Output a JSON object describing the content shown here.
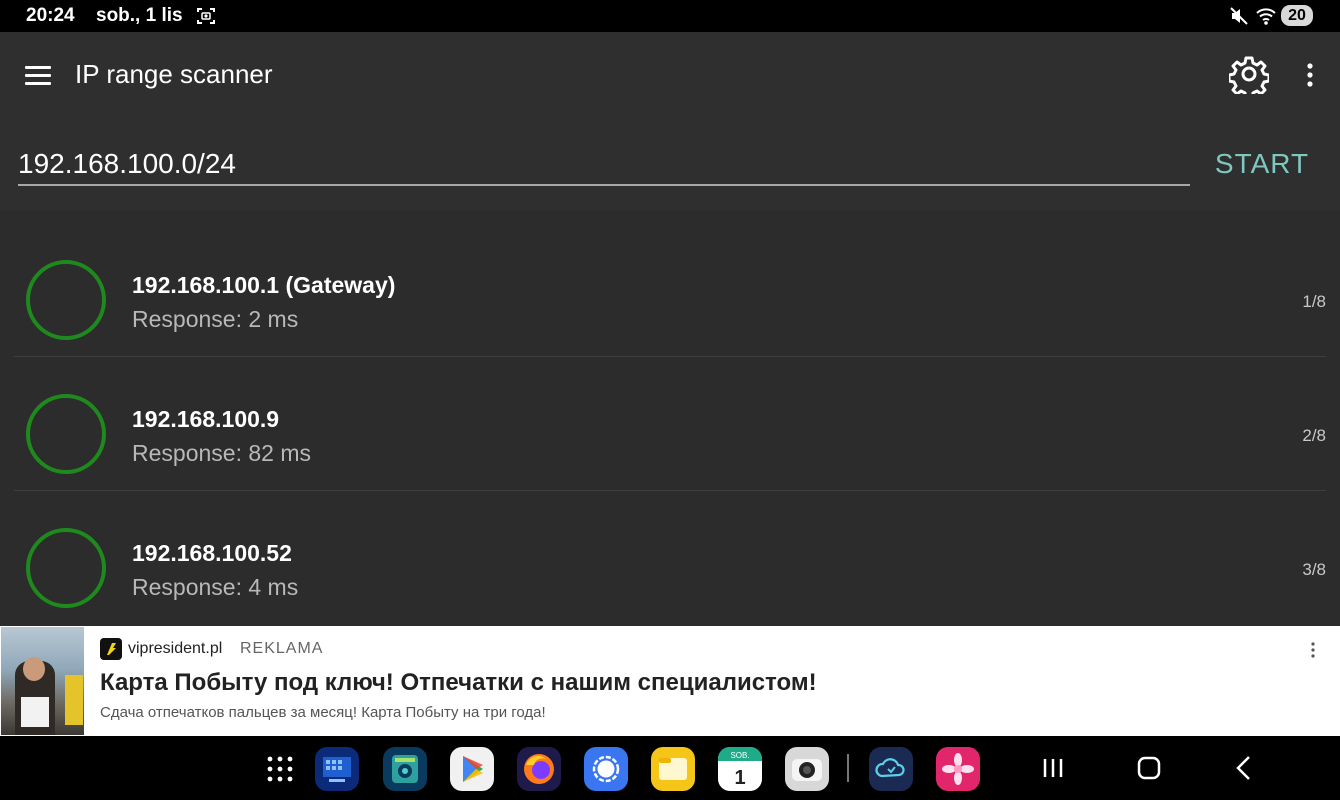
{
  "status_bar": {
    "time": "20:24",
    "date": "sob., 1 lis",
    "battery": "20",
    "icons": [
      "screenshot-icon",
      "mute-icon",
      "wifi-icon",
      "battery-icon"
    ]
  },
  "app_bar": {
    "title": "IP range scanner",
    "icons": [
      "menu-icon",
      "gear-icon",
      "overflow-menu-icon"
    ]
  },
  "scan": {
    "range_value": "192.168.100.0/24",
    "start_label": "START",
    "accent_color": "#7ec8c0"
  },
  "results": [
    {
      "host": "192.168.100.1 (Gateway)",
      "response": "Response: 2 ms",
      "counter": "1/8"
    },
    {
      "host": "192.168.100.9",
      "response": "Response: 82 ms",
      "counter": "2/8"
    },
    {
      "host": "192.168.100.52",
      "response": "Response: 4 ms",
      "counter": "3/8"
    }
  ],
  "status_ring_color": "#1e8a1e",
  "ad": {
    "source": "vipresident.pl",
    "label": "REKLAMA",
    "headline": "Карта Побыту под ключ! Отпечатки с нашим специалистом!",
    "description": "Сдача отпечатков пальцев за месяц! Карта Побыту на три года!"
  },
  "dock": {
    "apps": [
      "app-drawer-icon",
      "this-pc-app-icon",
      "system-app-icon",
      "play-store-icon",
      "firefox-icon",
      "signal-icon",
      "files-icon",
      "calendar-icon",
      "camera-icon",
      "cloud-app-icon",
      "gallery-icon"
    ],
    "calendar_day_label": "SOB.",
    "calendar_day_number": "1",
    "nav": [
      "recents-button",
      "home-button",
      "back-button"
    ]
  }
}
